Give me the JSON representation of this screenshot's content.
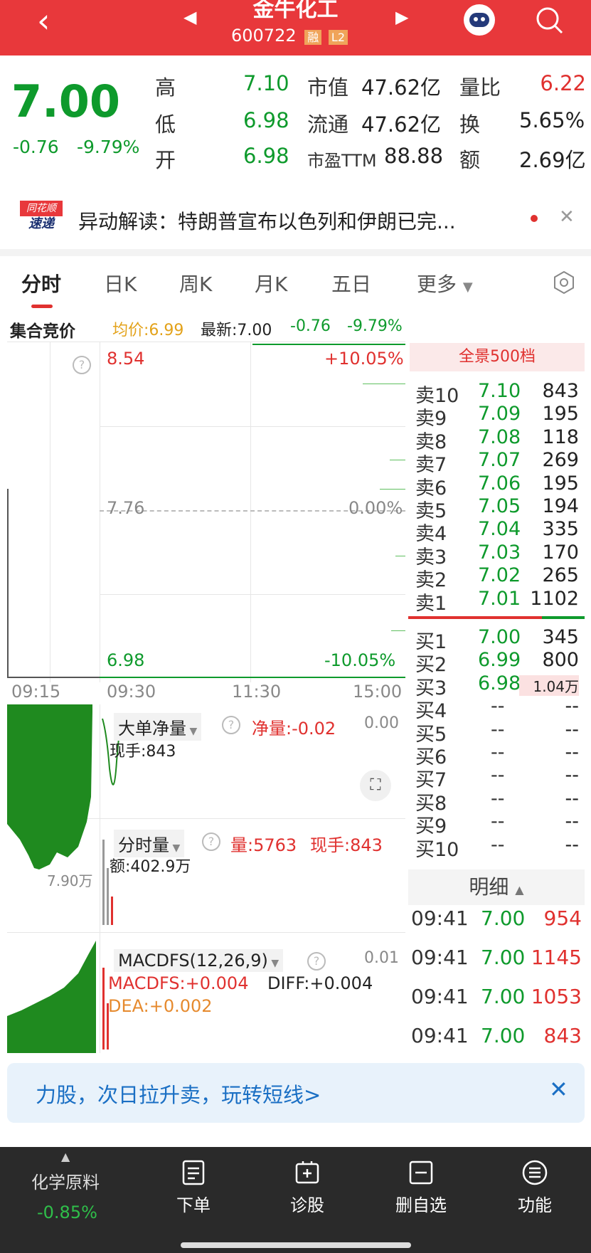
{
  "header": {
    "title": "金牛化工",
    "code": "600722",
    "badge1": "融",
    "badge2": "L2"
  },
  "quote": {
    "price": "7.00",
    "change": "-0.76",
    "change_pct": "-9.79%",
    "high_label": "高",
    "high": "7.10",
    "low_label": "低",
    "low": "6.98",
    "open_label": "开",
    "open": "6.98",
    "mcap_label": "市值",
    "mcap": "47.62亿",
    "float_label": "流通",
    "float": "47.62亿",
    "pe_label": "市盈TTM",
    "pe": "88.88",
    "vr_label": "量比",
    "vr": "6.22",
    "turn_label": "换",
    "turn": "5.65%",
    "amt_label": "额",
    "amt": "2.69亿"
  },
  "news": {
    "logo_top": "同花顺",
    "logo_bottom": "速递",
    "text": "异动解读：特朗普宣布以色列和伊朗已完..."
  },
  "tabs": [
    "分时",
    "日K",
    "周K",
    "月K",
    "五日",
    "更多"
  ],
  "info": {
    "auction": "集合竞价",
    "avg": "均价:6.99",
    "latest": "最新:7.00",
    "chg": "-0.76",
    "pct": "-9.79%"
  },
  "chart": {
    "top_price": "8.54",
    "top_pct": "+10.05%",
    "mid_price": "7.76",
    "mid_pct": "0.00%",
    "bot_price": "6.98",
    "bot_pct": "-10.05%",
    "t0": "09:15",
    "t1": "09:30",
    "t2": "11:30",
    "t3": "15:00"
  },
  "panels": {
    "big": {
      "name": "大单净量",
      "val": "净量:-0.02",
      "right": "0.00",
      "hand": "现手:843"
    },
    "vol": {
      "name": "分时量",
      "val": "量:5763",
      "hand": "现手:843",
      "amt": "额:402.9万",
      "left": "7.90万"
    },
    "macd": {
      "name": "MACDFS(12,26,9)",
      "right": "0.01",
      "macd": "MACDFS:+0.004",
      "diff": "DIFF:+0.004",
      "dea": "DEA:+0.002"
    }
  },
  "orderbook": {
    "title": "全景500档",
    "asks": [
      {
        "label": "卖10",
        "price": "7.10",
        "vol": "843"
      },
      {
        "label": "卖9",
        "price": "7.09",
        "vol": "195"
      },
      {
        "label": "卖8",
        "price": "7.08",
        "vol": "118"
      },
      {
        "label": "卖7",
        "price": "7.07",
        "vol": "269"
      },
      {
        "label": "卖6",
        "price": "7.06",
        "vol": "195"
      },
      {
        "label": "卖5",
        "price": "7.05",
        "vol": "194"
      },
      {
        "label": "卖4",
        "price": "7.04",
        "vol": "335"
      },
      {
        "label": "卖3",
        "price": "7.03",
        "vol": "170"
      },
      {
        "label": "卖2",
        "price": "7.02",
        "vol": "265"
      },
      {
        "label": "卖1",
        "price": "7.01",
        "vol": "1102"
      }
    ],
    "bids": [
      {
        "label": "买1",
        "price": "7.00",
        "vol": "345"
      },
      {
        "label": "买2",
        "price": "6.99",
        "vol": "800"
      },
      {
        "label": "买3",
        "price": "6.98",
        "vol": "1.04万"
      },
      {
        "label": "买4",
        "price": "--",
        "vol": "--"
      },
      {
        "label": "买5",
        "price": "--",
        "vol": "--"
      },
      {
        "label": "买6",
        "price": "--",
        "vol": "--"
      },
      {
        "label": "买7",
        "price": "--",
        "vol": "--"
      },
      {
        "label": "买8",
        "price": "--",
        "vol": "--"
      },
      {
        "label": "买9",
        "price": "--",
        "vol": "--"
      },
      {
        "label": "买10",
        "price": "--",
        "vol": "--"
      }
    ]
  },
  "details": {
    "title": "明细",
    "rows": [
      {
        "time": "09:41",
        "price": "7.00",
        "vol": "954"
      },
      {
        "time": "09:41",
        "price": "7.00",
        "vol": "1145"
      },
      {
        "time": "09:41",
        "price": "7.00",
        "vol": "1053"
      },
      {
        "time": "09:41",
        "price": "7.00",
        "vol": "843"
      }
    ]
  },
  "ad": {
    "text": "力股，次日拉升卖，玩转短线>"
  },
  "bottom": {
    "sector": "化学原料",
    "sector_chg": "-0.85%",
    "items": [
      "下单",
      "诊股",
      "删自选",
      "功能"
    ]
  },
  "colors": {
    "header": "#e8383b",
    "down": "#0e9a2c",
    "up": "#e0312f"
  }
}
